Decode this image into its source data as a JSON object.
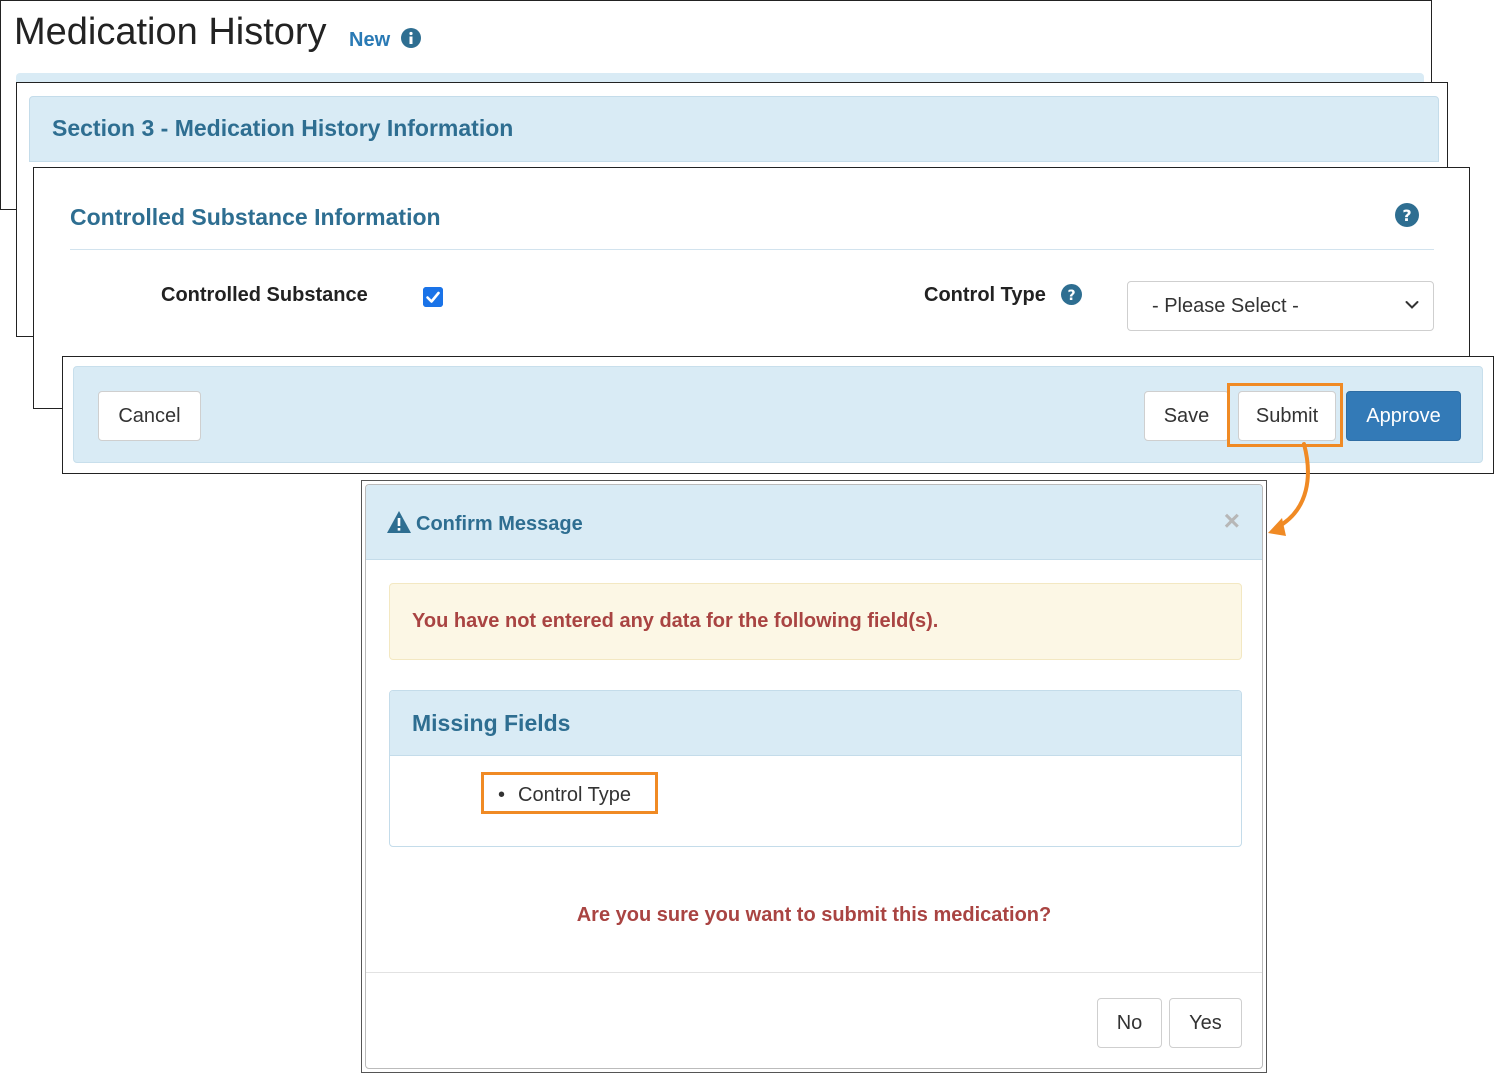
{
  "page": {
    "title": "Medication History",
    "status": "New",
    "status_icon": "info-circle-icon"
  },
  "section": {
    "title": "Section 3 - Medication History Information"
  },
  "controlled_substance": {
    "title": "Controlled Substance Information",
    "help_icon": "question-circle-icon",
    "checkbox_label": "Controlled Substance",
    "checkbox_checked": true,
    "control_type_label": "Control Type",
    "control_type_value": "- Please Select -"
  },
  "actions": {
    "cancel": "Cancel",
    "save": "Save",
    "submit": "Submit",
    "approve": "Approve"
  },
  "modal": {
    "title": "Confirm Message",
    "icon": "warning-triangle-icon",
    "close": "×",
    "alert": "You have not entered any data for the following field(s).",
    "missing_title": "Missing Fields",
    "missing_fields": [
      "Control Type"
    ],
    "question": "Are you sure you want to submit this medication?",
    "no": "No",
    "yes": "Yes"
  },
  "colors": {
    "accent": "#2e6e91",
    "panel_bg": "#d9ebf5",
    "primary_button": "#337ab7",
    "error_text": "#a94442",
    "warning_bg": "#fcf7e5",
    "highlight": "#f08a24"
  }
}
